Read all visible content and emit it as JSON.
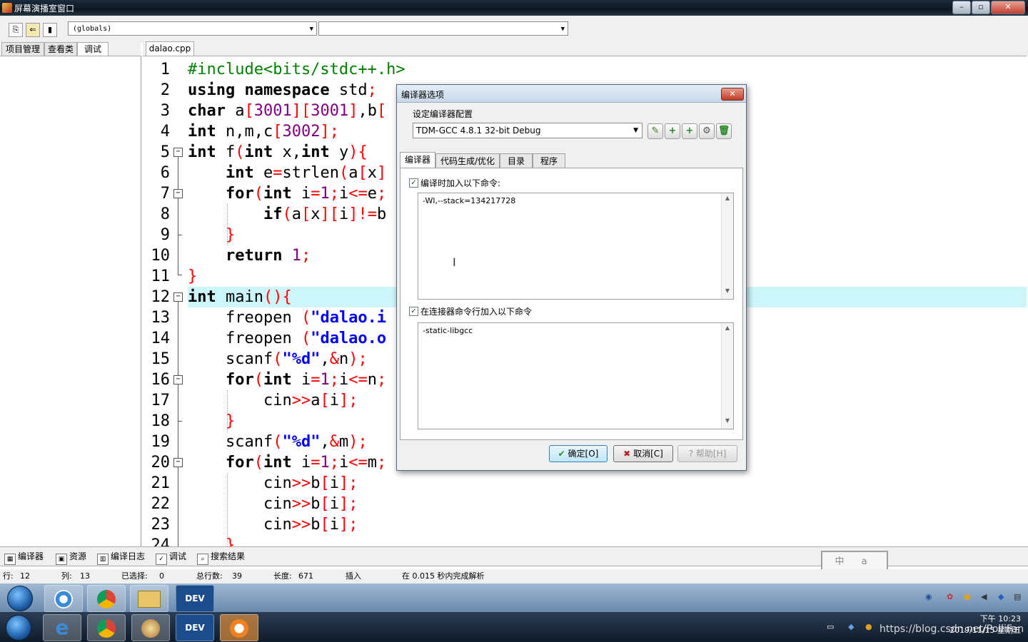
{
  "window": {
    "title": "屏幕演播室窗口"
  },
  "toolbar": {
    "scope_combo": "(globals)",
    "member_combo": ""
  },
  "left_panel": {
    "tabs": [
      "项目管理",
      "查看类",
      "调试"
    ],
    "active_tab": "调试"
  },
  "editor": {
    "file_tab": "dalao.cpp",
    "highlighted_line": 12,
    "line_numbers": [
      "1",
      "2",
      "3",
      "4",
      "5",
      "6",
      "7",
      "8",
      "9",
      "10",
      "11",
      "12",
      "13",
      "14",
      "15",
      "16",
      "17",
      "18",
      "19",
      "20",
      "21",
      "22",
      "23",
      "24"
    ]
  },
  "dialog": {
    "title": "编译器选项",
    "config_label": "设定编译器配置",
    "config_value": "TDM-GCC 4.8.1 32-bit Debug",
    "tabs": [
      "编译器",
      "代码生成/优化",
      "目录",
      "程序"
    ],
    "active_tab": "编译器",
    "compile_check_label": "编译时加入以下命令:",
    "compile_checked": true,
    "compile_commands": "-Wl,--stack=134217728",
    "linker_check_label": "在连接器命令行加入以下命令",
    "linker_checked": true,
    "linker_commands": "-static-libgcc",
    "ok_label": "确定[O]",
    "cancel_label": "取消[C]",
    "help_label": "帮助[H]"
  },
  "bottom_tabs": [
    "编译器",
    "资源",
    "编译日志",
    "调试",
    "搜索结果"
  ],
  "status": {
    "row_label": "行:",
    "row": "12",
    "col_label": "列:",
    "col": "13",
    "sel_label": "已选择:",
    "sel": "0",
    "total_label": "总行数:",
    "total": "39",
    "len_label": "长度:",
    "len": "671",
    "mode": "插入",
    "parse": "在 0.015 秒内完成解析"
  },
  "stamp": "中 a 体",
  "taskbar": {
    "dev_label": "DEV",
    "clock_time": "下午 10:23",
    "clock_date": "2019/11/15 星期五",
    "watermark": "https://blog.csdn.net/PolliFan"
  },
  "colors": {
    "keyword": "#000000",
    "preprocessor": "#008000",
    "symbol": "#ff0000",
    "number": "#800080",
    "string": "#0000ff",
    "highlight_line": "#cdf6fb"
  }
}
